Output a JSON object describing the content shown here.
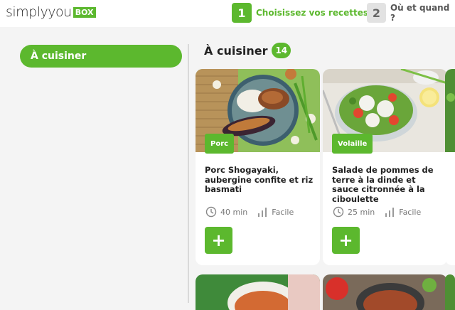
{
  "header": {
    "logo_text": "simplyyou",
    "logo_box": "BOX",
    "steps": [
      {
        "number": "1",
        "label": "Choisissez vos recettes",
        "active": true
      },
      {
        "number": "2",
        "label": "Où et quand ?",
        "active": false
      }
    ]
  },
  "sidebar": {
    "items": [
      {
        "label": "À cuisiner",
        "active": true
      }
    ]
  },
  "main": {
    "title": "À cuisiner",
    "count": "14",
    "recipes": [
      {
        "tag": "Porc",
        "title": "Porc Shogayaki, aubergine confite et riz basmati",
        "time": "40 min",
        "level": "Facile",
        "add_label": "+"
      },
      {
        "tag": "Volaille",
        "title": "Salade de pommes de terre à la dinde et sauce citronnée à la ciboulette",
        "time": "25 min",
        "level": "Facile",
        "add_label": "+"
      }
    ]
  },
  "icons": {
    "clock": "clock-icon",
    "difficulty": "difficulty-bars-icon",
    "add": "plus-icon"
  },
  "colors": {
    "accent": "#5cb82e"
  }
}
